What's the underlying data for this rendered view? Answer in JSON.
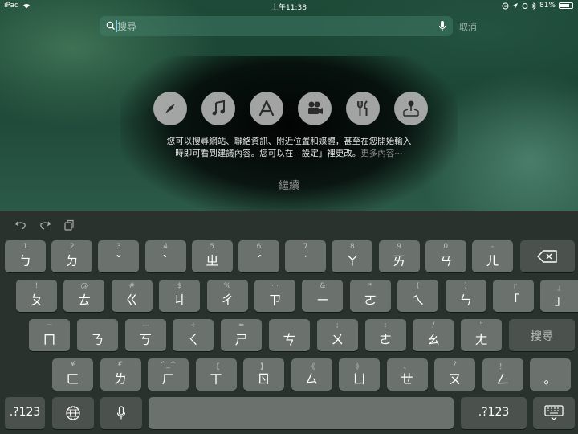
{
  "status_bar": {
    "device": "iPad",
    "time": "上午11:38",
    "battery": "81%",
    "battery_level": 0.81
  },
  "search": {
    "placeholder": "搜尋",
    "cancel_label": "取消"
  },
  "suggestions": {
    "icons": [
      "compass-icon",
      "music-note-icon",
      "app-store-icon",
      "movie-camera-icon",
      "restaurant-icon",
      "map-pin-icon"
    ],
    "description_line1": "您可以搜尋網站、聯絡資訊、附近位置和媒體，甚至在您開始輸入",
    "description_line2": "時即可看到建議內容。您可以在「設定」裡更改。",
    "more_link": "更多內容⋯",
    "continue_label": "繼續"
  },
  "keyboard": {
    "row1": [
      {
        "top": "1",
        "main": "ㄅ"
      },
      {
        "top": "2",
        "main": "ㄉ"
      },
      {
        "top": "3",
        "main": "ˇ"
      },
      {
        "top": "4",
        "main": "ˋ"
      },
      {
        "top": "5",
        "main": "ㄓ"
      },
      {
        "top": "6",
        "main": "ˊ"
      },
      {
        "top": "7",
        "main": "˙"
      },
      {
        "top": "8",
        "main": "ㄚ"
      },
      {
        "top": "9",
        "main": "ㄞ"
      },
      {
        "top": "0",
        "main": "ㄢ"
      },
      {
        "top": "-",
        "main": "ㄦ"
      }
    ],
    "row2": [
      {
        "top": "!",
        "main": "ㄆ"
      },
      {
        "top": "@",
        "main": "ㄊ"
      },
      {
        "top": "#",
        "main": "ㄍ"
      },
      {
        "top": "$",
        "main": "ㄐ"
      },
      {
        "top": "%",
        "main": "ㄔ"
      },
      {
        "top": "⋯",
        "main": "ㄗ"
      },
      {
        "top": "&",
        "main": "ㄧ"
      },
      {
        "top": "*",
        "main": "ㄛ"
      },
      {
        "top": "(",
        "main": "ㄟ"
      },
      {
        "top": ")",
        "main": "ㄣ"
      },
      {
        "top": "『",
        "main": "「"
      },
      {
        "top": "』",
        "main": "」"
      }
    ],
    "row3": [
      {
        "top": "~",
        "main": "ㄇ"
      },
      {
        "top": "",
        "main": "ㄋ"
      },
      {
        "top": "—",
        "main": "ㄎ"
      },
      {
        "top": "+",
        "main": "ㄑ"
      },
      {
        "top": "=",
        "main": "ㄕ"
      },
      {
        "top": "",
        "main": "ㄘ"
      },
      {
        "top": ";",
        "main": "ㄨ"
      },
      {
        "top": ":",
        "main": "ㄜ"
      },
      {
        "top": "/",
        "main": "ㄠ"
      },
      {
        "top": "\"",
        "main": "ㄤ"
      }
    ],
    "search_key": "搜尋",
    "row4": [
      {
        "top": "¥",
        "main": "ㄈ"
      },
      {
        "top": "€",
        "main": "ㄌ"
      },
      {
        "top": "^_^",
        "main": "ㄏ"
      },
      {
        "top": "【",
        "main": "ㄒ"
      },
      {
        "top": "】",
        "main": "ㄖ"
      },
      {
        "top": "《",
        "main": "ㄙ"
      },
      {
        "top": "》",
        "main": "ㄩ"
      },
      {
        "top": "、",
        "main": "ㄝ"
      },
      {
        "top": "?",
        "main": "ㄡ"
      },
      {
        "top": "！",
        "main": "ㄥ"
      },
      {
        "top": "",
        "main": "。"
      }
    ],
    "numbers_key_left": ".?123",
    "numbers_key_right": ".?123"
  }
}
